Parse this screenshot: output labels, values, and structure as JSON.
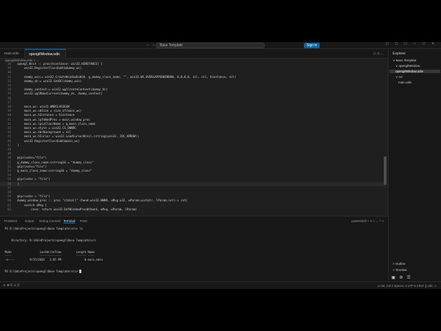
{
  "titlebar": {
    "nav_arrows": "← →",
    "search_text": "Base Template",
    "signin_label": "Sign in",
    "window_controls": "□ □ □ − □ ×"
  },
  "tabs": [
    {
      "label": "main.odin"
    },
    {
      "label": "opengl/Window.odin ×"
    }
  ],
  "tab_actions": "▷ ≡ …",
  "breadcrumb": "opengl/Window.odin > …",
  "code": [
    {
      "n": "28",
      "t": "opengl_init :: proc(hinstance: win32.HINSTANCE) {"
    },
    {
      "n": "29",
      "t": "    win32.RegisterClassExW(&dummy_wc)"
    },
    {
      "n": "30",
      "t": ""
    },
    {
      "n": "31",
      "t": "    dummy_win:= win32.CreateWindowExW(0, g_dummy_class_name, \"\", win32.WS_OVERLAPPEDWINDOW, 0,0,0,0, nil, nil, hinstance, nil)"
    },
    {
      "n": "32",
      "t": "    dummy_dc:= win32.GetDC(dummy_win)"
    },
    {
      "n": "33",
      "t": ""
    },
    {
      "n": "34",
      "t": "    dummy_context:= win32.wglCreateContext(dummy_dc)"
    },
    {
      "n": "35",
      "t": "    win32.wglMakeCurrent(dummy_dc, dummy_context)"
    },
    {
      "n": "36",
      "t": ""
    },
    {
      "n": "37",
      "t": ""
    },
    {
      "n": "38",
      "t": "    main_wc: win32.WNDCLASSEXW"
    },
    {
      "n": "39",
      "t": "    main_wc.cbSize = size_of(main_wc)"
    },
    {
      "n": "40",
      "t": "    main_wc.hInstance = hinstance"
    },
    {
      "n": "41",
      "t": "    main_wc.lpfnWndProc = main_window_proc"
    },
    {
      "n": "42",
      "t": "    main_wc.lpszClassName = g_main_class_name"
    },
    {
      "n": "43",
      "t": "    main_wc.style = win32.CS_OWNDC"
    },
    {
      "n": "44",
      "t": "    main_wc.hbrBackground = nil"
    },
    {
      "n": "45",
      "t": "    main_wc.hCursor = win32.LoadCursorW(nil,cstring(win32._IDC_ARROW))"
    },
    {
      "n": "46",
      "t": "    win32.RegisterClassExW(&main_wc)"
    },
    {
      "n": "47",
      "t": "}"
    },
    {
      "n": "48",
      "t": ""
    },
    {
      "n": "49",
      "t": ""
    },
    {
      "n": "50",
      "t": "@(private=\"file\")"
    },
    {
      "n": "51",
      "t": "g_dummy_class_name:cstring16 = \"dummy_class\""
    },
    {
      "n": "52",
      "t": "@(private=\"file\")"
    },
    {
      "n": "53",
      "t": "g_main_class_name:cstring16 = \"dummy_class\""
    },
    {
      "n": "54",
      "t": ""
    },
    {
      "n": "55",
      "t": "@(private = \"file\")"
    },
    {
      "n": "56",
      "t": "|"
    },
    {
      "n": "57",
      "t": ""
    },
    {
      "n": "58",
      "t": ""
    },
    {
      "n": "59",
      "t": "@(private = \"file\")"
    },
    {
      "n": "60",
      "t": "dummy_window_proc :: proc \"stdcall\" (hwnd:win32.HWND, uMsg:u32, wParam:uintptr, lParam:int)-> int{"
    },
    {
      "n": "61",
      "t": "    switch uMsg {"
    },
    {
      "n": "62",
      "t": "        case: return win32.DefWindowProcW(hwnd, uMsg, wParam, lParam)"
    }
  ],
  "panel": {
    "tabs": [
      "Problems",
      "Output",
      "Debug Console",
      "Terminal",
      "Ports"
    ],
    "right": "powershell + ∨ □ … ^ ×",
    "terminal_lines": [
      "PS D:\\OdinProjects\\opengl\\Base Template\\src> ls",
      "",
      "",
      "    Directory: D:\\OdinProjects\\opengl\\Base Template\\src",
      "",
      "",
      "Mode                 LastWriteTime         Length Name",
      "----                 -------------         ------ ----",
      "-a----         9/25/2026   2:05 PM              0 main.odin",
      "",
      "",
      "PS D:\\OdinProjects\\opengl\\Base Template\\src> "
    ]
  },
  "sidebar": {
    "title": "Explorer",
    "items": [
      {
        "label": "∨ Base Template"
      },
      {
        "label": "∨ opengl/Window"
      },
      {
        "label": "opengl/Window.odin"
      },
      {
        "label": "∨ src"
      },
      {
        "label": "main.odin"
      }
    ],
    "outline": "> Outline",
    "timeline": "> Timeline"
  },
  "status": {
    "left": "⨯  ⊗ 0 ⚠ 0",
    "right": "Ln 56, Col 2    Spaces: 4    UTF-8    CRLF    {}  odin    ☺"
  },
  "colors": {
    "accent": "#0078d4",
    "editor_bg": "#1f1f1f",
    "chrome_bg": "#181818"
  }
}
